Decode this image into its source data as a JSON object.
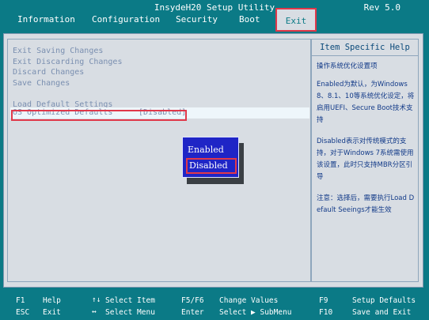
{
  "title": "InsydeH20 Setup Utility",
  "revision": "Rev 5.0",
  "tabs": [
    "Information",
    "Configuration",
    "Security",
    "Boot",
    "Exit"
  ],
  "menu": {
    "items": [
      "Exit Saving Changes",
      "Exit Discarding Changes",
      "Discard Changes",
      "Save Changes",
      "Load Default Settings"
    ],
    "os_optimized": {
      "label": "OS Optimized Defaults",
      "value": "[Disabled]"
    }
  },
  "popup": {
    "options": [
      "Enabled",
      "Disabled"
    ],
    "selected": "Disabled"
  },
  "help": {
    "header": "Item Specific Help",
    "paragraphs": [
      "操作系统优化设置项",
      "Enabled为默认，为Windows 8、8.1、10等系统优化设定，将启用UEFI、Secure Boot技术支持",
      "Disabled表示对传统模式的支持，对于Windows 7系统需使用该设置，此时只支持MBR分区引导",
      "注意：选择后，需要执行Load Default Seeings才能生效"
    ]
  },
  "footer": {
    "items": [
      {
        "key": "F1",
        "desc": "Help"
      },
      {
        "key": "ESC",
        "desc": "Exit"
      },
      {
        "key": "↑↓",
        "desc": "Select Item"
      },
      {
        "key": "↔",
        "desc": "Select Menu"
      },
      {
        "key": "F5/F6",
        "desc": "Change Values"
      },
      {
        "key": "Enter",
        "desc": "Select ▶ SubMenu"
      },
      {
        "key": "F9",
        "desc": "Setup Defaults"
      },
      {
        "key": "F10",
        "desc": "Save and Exit"
      }
    ]
  },
  "colors": {
    "background": "#0b7a86",
    "panel": "#d8dde3",
    "highlight_border": "#e0384a",
    "popup_bg": "#1f25c6"
  }
}
